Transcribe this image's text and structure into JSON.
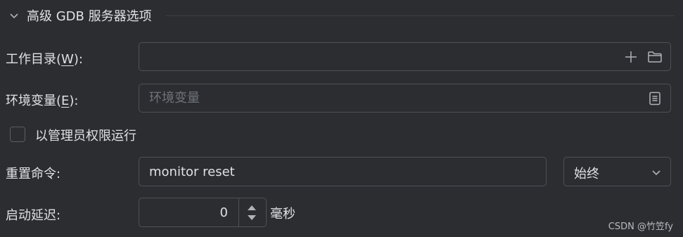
{
  "section": {
    "title": "高级 GDB 服务器选项",
    "expanded": true
  },
  "working_dir": {
    "label_pre": "工作目录(",
    "label_mnemonic": "W",
    "label_post": "):",
    "value": "",
    "placeholder": ""
  },
  "env_vars": {
    "label_pre": "环境变量(",
    "label_mnemonic": "E",
    "label_post": "):",
    "value": "",
    "placeholder": "环境变量"
  },
  "run_as_admin": {
    "label": "以管理员权限运行",
    "checked": false
  },
  "reset_command": {
    "label": "重置命令:",
    "value": "monitor reset",
    "mode": "始终"
  },
  "startup_delay": {
    "label": "启动延迟:",
    "value": "0",
    "unit": "毫秒"
  },
  "watermark": "CSDN @竹笠fy",
  "icons": [
    "chevron-down-icon",
    "plus-icon",
    "folder-icon",
    "list-document-icon",
    "chevron-down-icon",
    "spin-up-icon",
    "spin-down-icon"
  ],
  "colors": {
    "background": "#2b2d30",
    "text": "#dfe1e5",
    "border": "#4e5157",
    "placeholder": "#6f737a",
    "icon": "#b0b3b8"
  }
}
